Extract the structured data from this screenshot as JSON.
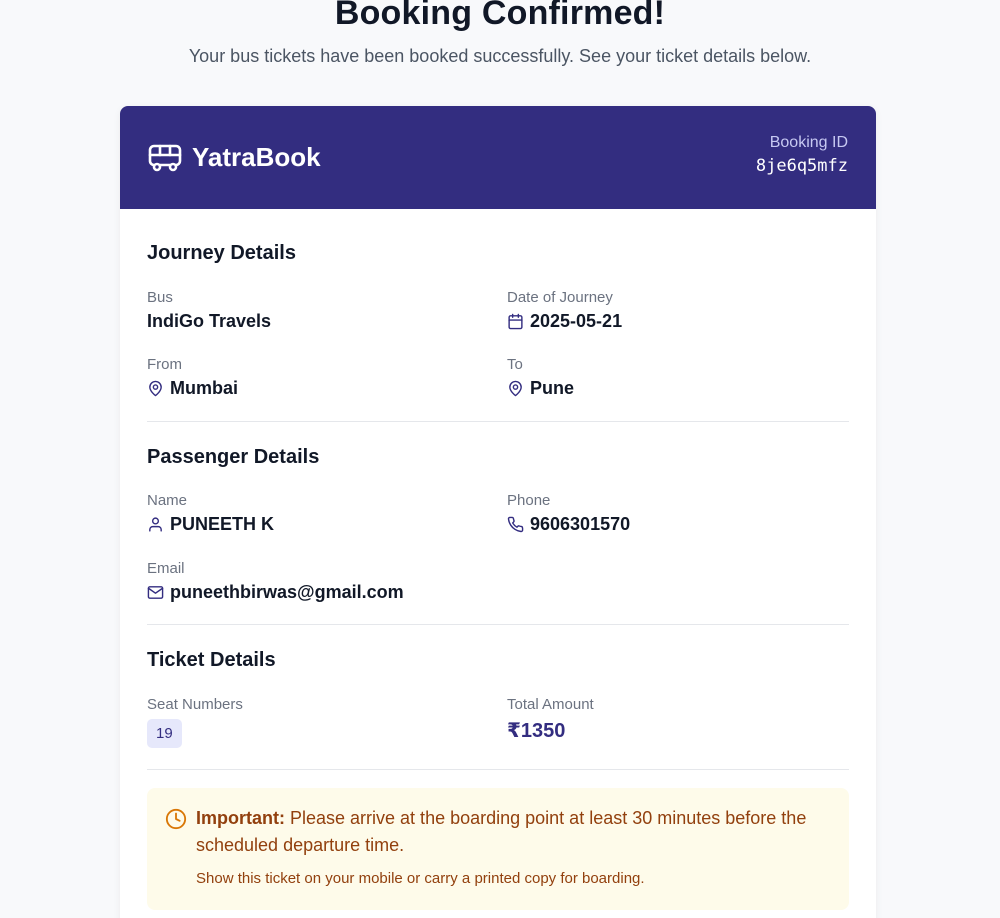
{
  "page": {
    "title": "Booking Confirmed!",
    "subtitle": "Your bus tickets have been booked successfully. See your ticket details below."
  },
  "header": {
    "brand": "YatraBook",
    "brand_icon": "bus-icon",
    "booking_id_label": "Booking ID",
    "booking_id": "8je6q5mfz",
    "color": "#332d80"
  },
  "journey": {
    "title": "Journey Details",
    "bus_label": "Bus",
    "bus": "IndiGo Travels",
    "date_label": "Date of Journey",
    "date": "2025-05-21",
    "from_label": "From",
    "from": "Mumbai",
    "to_label": "To",
    "to": "Pune"
  },
  "passenger": {
    "title": "Passenger Details",
    "name_label": "Name",
    "name": "PUNEETH K",
    "phone_label": "Phone",
    "phone": "9606301570",
    "email_label": "Email",
    "email": "puneethbirwas@gmail.com"
  },
  "ticket": {
    "title": "Ticket Details",
    "seats_label": "Seat Numbers",
    "seats": [
      "19"
    ],
    "amount_label": "Total Amount",
    "amount": "₹1350"
  },
  "notice": {
    "strong": "Important:",
    "text": " Please arrive at the boarding point at least 30 minutes before the scheduled departure time.",
    "sub": "Show this ticket on your mobile or carry a printed copy for boarding.",
    "color": "#92400e",
    "background": "#fefbea"
  }
}
